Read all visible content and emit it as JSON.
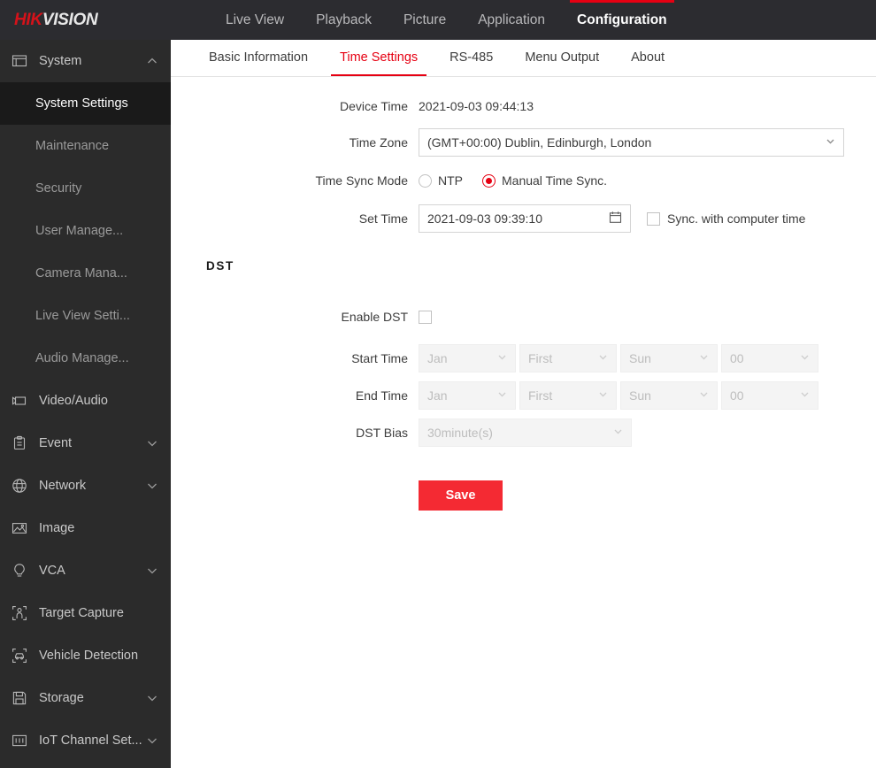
{
  "brand": {
    "part1": "HIK",
    "part2": "VISION"
  },
  "topnav": {
    "items": [
      {
        "label": "Live View",
        "active": false
      },
      {
        "label": "Playback",
        "active": false
      },
      {
        "label": "Picture",
        "active": false
      },
      {
        "label": "Application",
        "active": false
      },
      {
        "label": "Configuration",
        "active": true
      }
    ]
  },
  "sidebar": {
    "groups": [
      {
        "label": "System",
        "icon": "window-icon",
        "chevron": "up",
        "expanded": true
      },
      {
        "label": "Video/Audio",
        "icon": "camera-icon",
        "chevron": "none"
      },
      {
        "label": "Event",
        "icon": "clipboard-icon",
        "chevron": "down"
      },
      {
        "label": "Network",
        "icon": "globe-icon",
        "chevron": "down"
      },
      {
        "label": "Image",
        "icon": "image-icon",
        "chevron": "none"
      },
      {
        "label": "VCA",
        "icon": "bulb-icon",
        "chevron": "down"
      },
      {
        "label": "Target Capture",
        "icon": "person-frame-icon",
        "chevron": "none"
      },
      {
        "label": "Vehicle Detection",
        "icon": "car-frame-icon",
        "chevron": "none"
      },
      {
        "label": "Storage",
        "icon": "floppy-icon",
        "chevron": "down"
      },
      {
        "label": "IoT Channel Set...",
        "icon": "iot-icon",
        "chevron": "down"
      }
    ],
    "system_items": [
      {
        "label": "System Settings",
        "active": true
      },
      {
        "label": "Maintenance",
        "active": false
      },
      {
        "label": "Security",
        "active": false
      },
      {
        "label": "User Manage...",
        "active": false
      },
      {
        "label": "Camera Mana...",
        "active": false
      },
      {
        "label": "Live View Setti...",
        "active": false
      },
      {
        "label": "Audio Manage...",
        "active": false
      }
    ]
  },
  "tabs": [
    {
      "label": "Basic Information",
      "active": false
    },
    {
      "label": "Time Settings",
      "active": true
    },
    {
      "label": "RS-485",
      "active": false
    },
    {
      "label": "Menu Output",
      "active": false
    },
    {
      "label": "About",
      "active": false
    }
  ],
  "form": {
    "device_time_label": "Device Time",
    "device_time_value": "2021-09-03 09:44:13",
    "time_zone_label": "Time Zone",
    "time_zone_value": "(GMT+00:00) Dublin, Edinburgh, London",
    "time_sync_label": "Time Sync Mode",
    "ntp_label": "NTP",
    "ntp_selected": false,
    "manual_label": "Manual Time Sync.",
    "manual_selected": true,
    "set_time_label": "Set Time",
    "set_time_value": "2021-09-03 09:39:10",
    "sync_computer_label": "Sync. with computer time",
    "sync_computer_checked": false
  },
  "dst": {
    "title": "DST",
    "enable_label": "Enable DST",
    "enable_checked": false,
    "start_label": "Start Time",
    "start_month": "Jan",
    "start_week": "First",
    "start_day": "Sun",
    "start_hour": "00",
    "end_label": "End Time",
    "end_month": "Jan",
    "end_week": "First",
    "end_day": "Sun",
    "end_hour": "00",
    "bias_label": "DST Bias",
    "bias_value": "30minute(s)"
  },
  "actions": {
    "save_label": "Save"
  },
  "colors": {
    "accent": "#e60012",
    "save_bg": "#f42a33",
    "header_bg": "#2c2c30",
    "sidebar_bg": "#2b2b2b"
  }
}
